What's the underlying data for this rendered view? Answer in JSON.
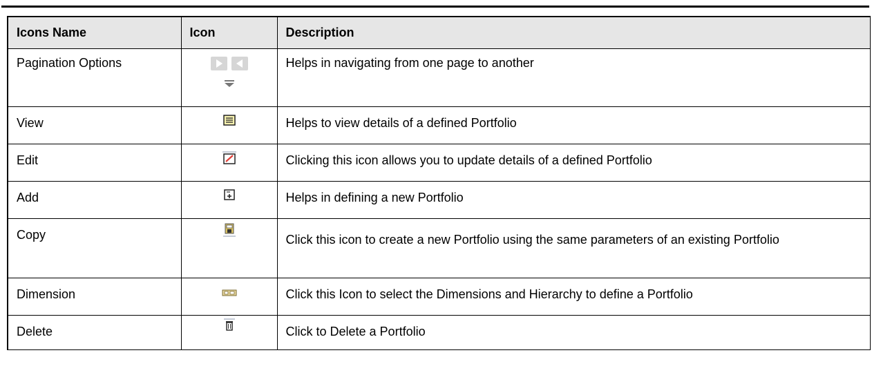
{
  "table": {
    "headers": [
      "Icons Name",
      "Icon",
      "Description"
    ],
    "rows": [
      {
        "name": "Pagination Options",
        "icon": "pagination-icon",
        "description": "Helps in navigating from one page to another"
      },
      {
        "name": "View",
        "icon": "view-icon",
        "description": "Helps to view details of a defined Portfolio"
      },
      {
        "name": "Edit",
        "icon": "edit-icon",
        "description": "Clicking this icon allows you to update details of a defined Portfolio"
      },
      {
        "name": "Add",
        "icon": "add-icon",
        "description": "Helps in defining a new Portfolio"
      },
      {
        "name": "Copy",
        "icon": "copy-icon",
        "description": "Click this icon to create a new Portfolio using the same parameters of an existing Portfolio"
      },
      {
        "name": "Dimension",
        "icon": "dimension-icon",
        "description": "Click this Icon to select the Dimensions and Hierarchy to define a Portfolio"
      },
      {
        "name": "Delete",
        "icon": "delete-icon",
        "description": "Click to Delete a Portfolio"
      }
    ]
  },
  "colors": {
    "header_bg": "#e6e6e6",
    "border": "#000000"
  }
}
